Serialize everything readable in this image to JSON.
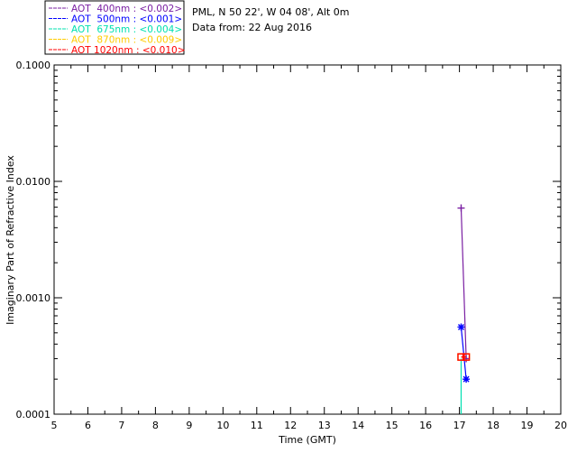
{
  "header": {
    "location": "PML, N 50 22', W 04 08', Alt 0m",
    "date_text": "Data from: 22 Aug 2016"
  },
  "chart_data": {
    "type": "line",
    "xlabel": "Time (GMT)",
    "ylabel": "Imaginary Part of Refractive Index",
    "xlim": [
      5,
      20
    ],
    "ylim": [
      0.0001,
      0.1
    ],
    "yscale": "log",
    "xticks": [
      "5",
      "6",
      "7",
      "8",
      "9",
      "10",
      "11",
      "12",
      "13",
      "14",
      "15",
      "16",
      "17",
      "18",
      "19",
      "20"
    ],
    "yticks": [
      {
        "value": 0.0001,
        "label": "0.0001"
      },
      {
        "value": 0.001,
        "label": "0.0010"
      },
      {
        "value": 0.01,
        "label": "0.0100"
      },
      {
        "value": 0.1,
        "label": "0.1000"
      }
    ],
    "legend_position": "top-left",
    "series": [
      {
        "name": "AOT  400nm : <0.002>",
        "color": "#7a1fa2",
        "marker": "plus",
        "x": [
          17.05,
          17.2
        ],
        "y": [
          0.0059,
          0.0003
        ]
      },
      {
        "name": "AOT  500nm : <0.001>",
        "color": "#0000ff",
        "marker": "asterisk",
        "x": [
          17.05,
          17.2
        ],
        "y": [
          0.00056,
          0.0002
        ]
      },
      {
        "name": "AOT  675nm : <0.004>",
        "color": "#00e0b0",
        "marker": "none",
        "x": [
          17.05,
          17.05
        ],
        "y": [
          0.0003,
          0.0001
        ]
      },
      {
        "name": "AOT  870nm : <0.009>",
        "color": "#ffcc00",
        "marker": "square",
        "x": [
          17.05,
          17.2
        ],
        "y": [
          0.00031,
          0.00031
        ]
      },
      {
        "name": "AOT 1020nm : <0.010>",
        "color": "#ff0000",
        "marker": "square",
        "x": [
          17.05,
          17.2
        ],
        "y": [
          0.00031,
          0.00031
        ]
      }
    ]
  }
}
